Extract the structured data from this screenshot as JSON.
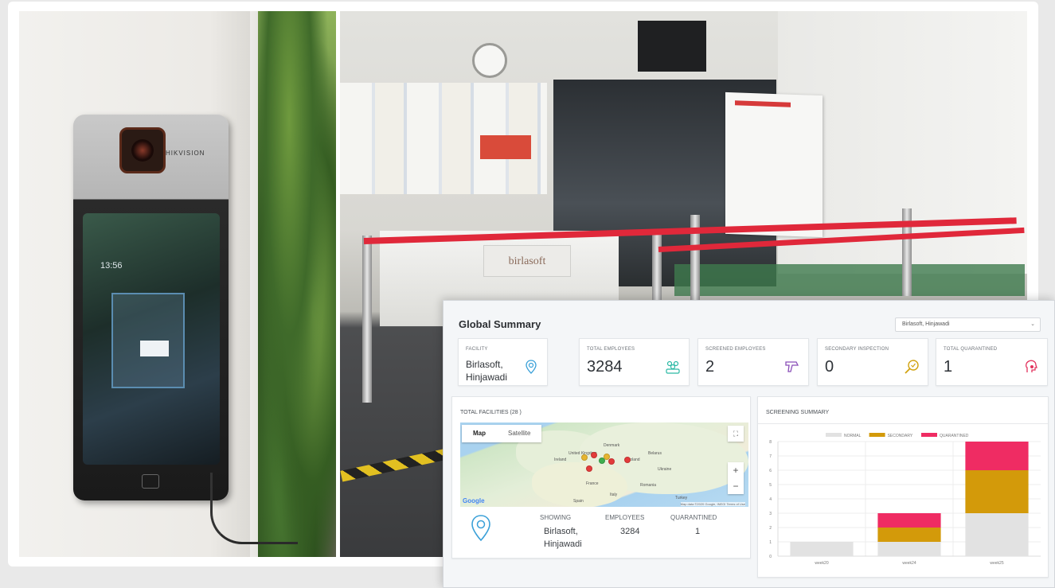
{
  "photo": {
    "device_brand": "HIKVISION",
    "device_time": "13:56",
    "desk_sign": "birlasoft"
  },
  "dashboard": {
    "title": "Global Summary",
    "facility_select": "Birlasoft, Hinjawadi",
    "kpis": {
      "facility": {
        "label": "FACILITY",
        "value_line1": "Birlasoft,",
        "value_line2": "Hinjawadi"
      },
      "total_employees": {
        "label": "TOTAL EMPLOYEES",
        "value": "3284"
      },
      "screened_employees": {
        "label": "SCREENED EMPLOYEES",
        "value": "2"
      },
      "secondary_inspection": {
        "label": "SECONDARY INSPECTION",
        "value": "0"
      },
      "total_quarantined": {
        "label": "TOTAL QUARANTINED",
        "value": "1"
      }
    },
    "facilities_card": {
      "title": "TOTAL FACILITIES (28 )",
      "map_tabs": [
        "Map",
        "Satellite"
      ],
      "map_brand": "Google",
      "map_attribution": "Map data ©2020 Google, INEGI   Terms of Use",
      "map_cities": [
        "Denmark",
        "United Kingdom",
        "Ireland",
        "Belarus",
        "Poland",
        "Ukraine",
        "France",
        "Romania",
        "Spain",
        "Italy",
        "Turkey"
      ],
      "stats": {
        "showing_label": "SHOWING",
        "showing_line1": "Birlasoft,",
        "showing_line2": "Hinjawadi",
        "employees_label": "EMPLOYEES",
        "employees_value": "3284",
        "quarantined_label": "QUARANTINED",
        "quarantined_value": "1"
      }
    },
    "screening_card": {
      "title": "SCREENING SUMMARY"
    }
  },
  "colors": {
    "normal": "#e2e2e2",
    "secondary": "#d39a0a",
    "quarantined": "#ef2c63",
    "accent_teal": "#2bb9a5",
    "accent_purple": "#8a4fb8",
    "accent_gold": "#d1a20f",
    "accent_red": "#e2315c"
  },
  "chart_data": {
    "type": "bar",
    "stacked": true,
    "categories": [
      "week20",
      "week24",
      "week25"
    ],
    "series": [
      {
        "name": "NORMAL",
        "values": [
          1,
          1,
          3
        ],
        "color": "#e2e2e2"
      },
      {
        "name": "SECONDARY",
        "values": [
          0,
          1,
          3
        ],
        "color": "#d39a0a"
      },
      {
        "name": "QUARANTINED",
        "values": [
          0,
          1,
          2
        ],
        "color": "#ef2c63"
      }
    ],
    "title": "",
    "xlabel": "",
    "ylabel": "",
    "ylim": [
      0,
      8
    ],
    "yticks": [
      0,
      1,
      2,
      3,
      4,
      5,
      6,
      7,
      8
    ],
    "grid": true,
    "legend": "top"
  }
}
